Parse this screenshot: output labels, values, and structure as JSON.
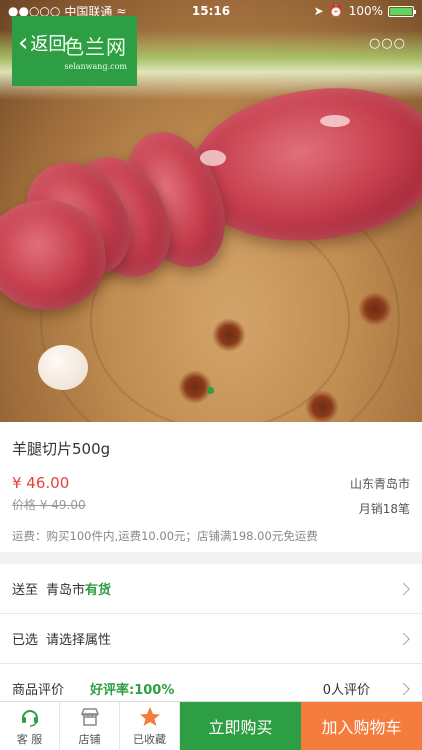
{
  "status_bar": {
    "carrier": "中国联通",
    "time": "15:16",
    "battery": "100%"
  },
  "header": {
    "logo_name": "色兰网",
    "logo_url": "selanwang.com",
    "back_label": "返回",
    "more_label": "○○○"
  },
  "product": {
    "title": "羊腿切片500g",
    "price": "¥ 46.00",
    "old_price": "价格 ¥ 49.00",
    "location": "山东青岛市",
    "sales": "月销18笔",
    "shipping": "运费：购买100件内,运费10.00元；店铺满198.00元免运费"
  },
  "options": {
    "delivery_label": "送至",
    "delivery_city": "青岛市",
    "delivery_stock": "有货",
    "selected_label": "已选",
    "selected_value": "请选择属性",
    "review_label": "商品评价",
    "review_rate": "好评率:100%",
    "review_count": "0人评价"
  },
  "bottom_bar": {
    "service_label": "客 服",
    "shop_label": "店铺",
    "favorite_label": "已收藏",
    "buy_label": "立即购买",
    "cart_label": "加入购物车"
  },
  "colors": {
    "brand_green": "#2e9e44",
    "cart_orange": "#f47c3c",
    "price_red": "#e8403a"
  }
}
